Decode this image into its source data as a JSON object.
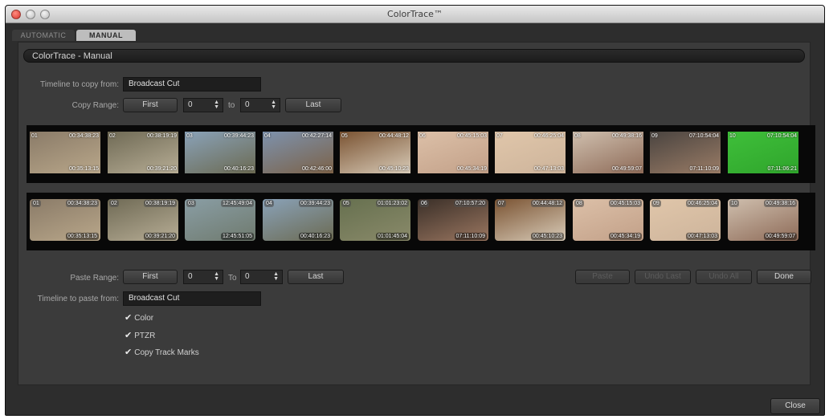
{
  "window": {
    "title": "ColorTrace™"
  },
  "tabs": [
    {
      "label": "AUTOMATIC",
      "selected": false
    },
    {
      "label": "MANUAL",
      "selected": true
    }
  ],
  "panel": {
    "title": "ColorTrace - Manual"
  },
  "copy": {
    "timeline_label": "Timeline to copy from:",
    "timeline_value": "Broadcast Cut",
    "range_label": "Copy Range:",
    "first_label": "First",
    "from_value": "0",
    "to_label": "to",
    "to_value": "0",
    "last_label": "Last"
  },
  "source_clips": [
    {
      "num": "01",
      "tc_in": "00:34:38:23",
      "tc_out": "00:35:13:15",
      "colors": [
        "#8a7b68",
        "#b9a78a"
      ]
    },
    {
      "num": "02",
      "tc_in": "00:38:19:19",
      "tc_out": "00:39:21:20",
      "colors": [
        "#6f6a55",
        "#b7ad95"
      ]
    },
    {
      "num": "03",
      "tc_in": "00:39:44:23",
      "tc_out": "00:40:16:23",
      "colors": [
        "#8aa2b8",
        "#6b6a52"
      ]
    },
    {
      "num": "04",
      "tc_in": "00:42:27:14",
      "tc_out": "00:42:46:00",
      "colors": [
        "#7d92ad",
        "#7c6248"
      ]
    },
    {
      "num": "05",
      "tc_in": "00:44:48:12",
      "tc_out": "00:45:10:23",
      "colors": [
        "#7a5332",
        "#d8cbb8"
      ]
    },
    {
      "num": "06",
      "tc_in": "00:45:15:03",
      "tc_out": "00:45:34:19",
      "colors": [
        "#dcc0a8",
        "#c2a088"
      ]
    },
    {
      "num": "07",
      "tc_in": "00:46:25:04",
      "tc_out": "00:47:13:03",
      "colors": [
        "#e0c6aa",
        "#cdb49b"
      ]
    },
    {
      "num": "08",
      "tc_in": "00:49:38:16",
      "tc_out": "00:49:59:07",
      "colors": [
        "#cfbfae",
        "#8e6b58"
      ]
    },
    {
      "num": "09",
      "tc_in": "07:10:54:04",
      "tc_out": "07:11:10:09",
      "colors": [
        "#4a4440",
        "#9a7c66"
      ]
    },
    {
      "num": "10",
      "tc_in": "07:10:54:04",
      "tc_out": "07:11:06:21",
      "colors": [
        "#3fbf3a",
        "#2fa52c"
      ]
    }
  ],
  "dest_clips": [
    {
      "num": "01",
      "tc_in": "00:34:38:23",
      "tc_out": "00:35:13:15",
      "colors": [
        "#8a7b68",
        "#b9a78a"
      ]
    },
    {
      "num": "02",
      "tc_in": "00:38:19:19",
      "tc_out": "00:39:21:20",
      "colors": [
        "#6f6a55",
        "#b7ad95"
      ]
    },
    {
      "num": "03",
      "tc_in": "12:45:49:04",
      "tc_out": "12:45:51:05",
      "colors": [
        "#8a9ea5",
        "#6f7a6e"
      ]
    },
    {
      "num": "04",
      "tc_in": "00:39:44:23",
      "tc_out": "00:40:16:23",
      "colors": [
        "#8aa2b8",
        "#6b6a52"
      ]
    },
    {
      "num": "05",
      "tc_in": "01:01:23:02",
      "tc_out": "01:01:45:04",
      "colors": [
        "#66704f",
        "#8a8a6a"
      ]
    },
    {
      "num": "06",
      "tc_in": "07:10:57:20",
      "tc_out": "07:11:10:09",
      "colors": [
        "#3a2f28",
        "#9a7660"
      ]
    },
    {
      "num": "07",
      "tc_in": "00:44:48:12",
      "tc_out": "00:45:10:23",
      "colors": [
        "#7a5332",
        "#d8cbb8"
      ]
    },
    {
      "num": "08",
      "tc_in": "00:45:15:03",
      "tc_out": "00:45:34:19",
      "colors": [
        "#dcc0a8",
        "#c2a088"
      ]
    },
    {
      "num": "09",
      "tc_in": "00:46:25:04",
      "tc_out": "00:47:13:03",
      "colors": [
        "#e0c6aa",
        "#cdb49b"
      ]
    },
    {
      "num": "10",
      "tc_in": "00:49:38:16",
      "tc_out": "00:49:59:07",
      "colors": [
        "#cfbfae",
        "#8e6b58"
      ]
    }
  ],
  "paste": {
    "range_label": "Paste Range:",
    "first_label": "First",
    "from_value": "0",
    "to_label": "To",
    "to_value": "0",
    "last_label": "Last",
    "timeline_label": "Timeline to paste from:",
    "timeline_value": "Broadcast Cut"
  },
  "actions": {
    "paste": "Paste",
    "undo_last": "Undo Last",
    "undo_all": "Undo All",
    "done": "Done"
  },
  "options": [
    {
      "label": "Color",
      "checked": true
    },
    {
      "label": "PTZR",
      "checked": true
    },
    {
      "label": "Copy Track Marks",
      "checked": true
    }
  ],
  "footer": {
    "close_label": "Close"
  }
}
